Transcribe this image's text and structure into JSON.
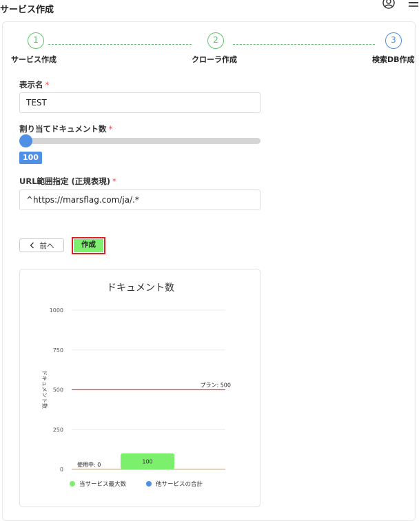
{
  "page": {
    "title": "サービス作成"
  },
  "header": {
    "user_icon": "user-circle-icon",
    "menu_icon": "hamburger-menu-icon"
  },
  "steps": [
    {
      "number": "1",
      "label": "サービス作成",
      "state": "done"
    },
    {
      "number": "2",
      "label": "クローラ作成",
      "state": "done"
    },
    {
      "number": "3",
      "label": "検索DB作成",
      "state": "active"
    }
  ],
  "form": {
    "display_name": {
      "label": "表示名",
      "required_mark": "*",
      "value": "TEST"
    },
    "document_allocation": {
      "label": "割り当てドキュメント数",
      "required_mark": "*",
      "value": "100"
    },
    "url_range": {
      "label": "URL範囲指定 (正規表現)",
      "required_mark": "*",
      "value": "^https://marsflag.com/ja/.*"
    }
  },
  "buttons": {
    "prev_label": "前へ",
    "prev_icon": "chevron-left-icon",
    "create_label": "作成"
  },
  "colors": {
    "accent_blue": "#4f8fe6",
    "step_green": "#5bc46b",
    "create_green": "#7cf06c",
    "highlight_red": "#e02020",
    "plan_line": "#e05252"
  },
  "chart_data": {
    "type": "bar",
    "title": "ドキュメント数",
    "ylabel": "ドキュメント数",
    "xlabel": "",
    "ylim": [
      0,
      1000
    ],
    "y_ticks": [
      0,
      250,
      500,
      750,
      1000
    ],
    "grid": true,
    "legend_position": "bottom",
    "series": [
      {
        "name": "当サービス最大数",
        "color": "#7cf06c",
        "values": [
          100
        ],
        "labels": [
          "100"
        ]
      },
      {
        "name": "他サービスの合計",
        "color": "#4f8fe6",
        "values": [
          0
        ]
      }
    ],
    "annotations": [
      {
        "label": "プラン: 500",
        "y": 500,
        "color": "#e05252"
      },
      {
        "label": "使用中: 0",
        "y": 0,
        "color": "#d9b98a"
      }
    ]
  }
}
